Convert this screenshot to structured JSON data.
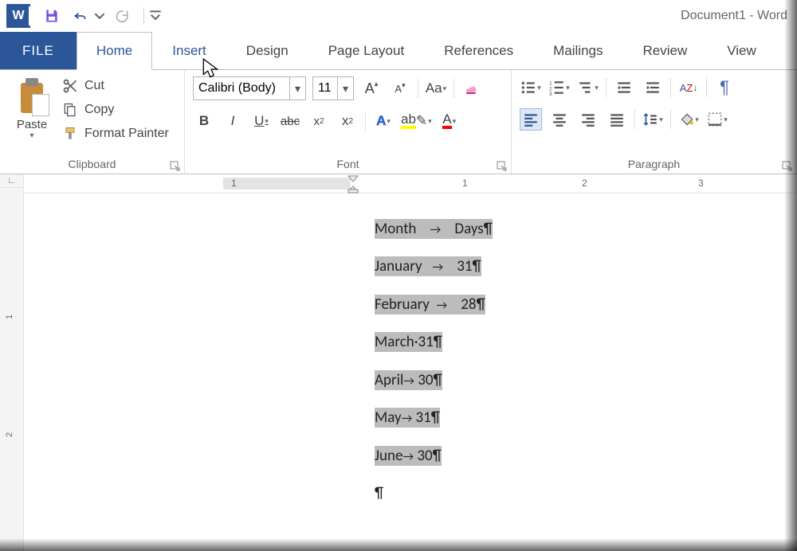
{
  "titlebar": {
    "title": "Document1 - Word"
  },
  "tabs": {
    "file": "FILE",
    "home": "Home",
    "insert": "Insert",
    "design": "Design",
    "pagelayout": "Page Layout",
    "references": "References",
    "mailings": "Mailings",
    "review": "Review",
    "view": "View"
  },
  "ribbon": {
    "clipboard": {
      "title": "Clipboard",
      "paste": "Paste",
      "cut": "Cut",
      "copy": "Copy",
      "format_painter": "Format Painter"
    },
    "font": {
      "title": "Font",
      "name": "Calibri (Body)",
      "size": "11"
    },
    "paragraph": {
      "title": "Paragraph"
    }
  },
  "ruler": {
    "marks": [
      "1",
      "1",
      "2",
      "3"
    ]
  },
  "document": {
    "lines": [
      {
        "a": "Month",
        "tabwide": true,
        "b": "Days"
      },
      {
        "a": "January",
        "tabwide": true,
        "b": "31"
      },
      {
        "a": "February",
        "tabwide": true,
        "b": "28"
      },
      {
        "a": "March",
        "mid": "·",
        "b": "31"
      },
      {
        "a": "April",
        "tab": true,
        "b": "30"
      },
      {
        "a": "May",
        "tab": true,
        "b": "31"
      },
      {
        "a": "June",
        "tab": true,
        "b": "30"
      }
    ]
  }
}
